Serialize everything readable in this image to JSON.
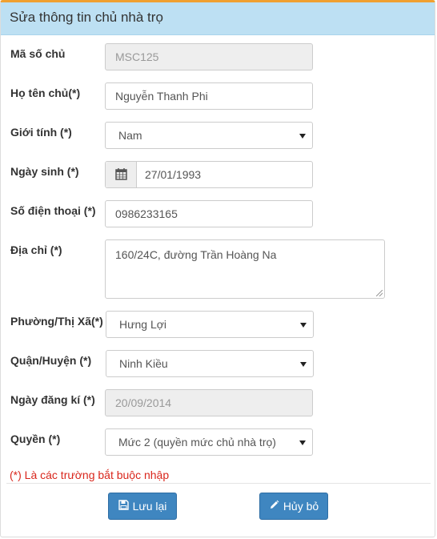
{
  "header": {
    "title": "Sửa thông tin chủ nhà trọ"
  },
  "fields": {
    "owner_id": {
      "label": "Mã số chủ",
      "value": "MSC125"
    },
    "full_name": {
      "label": "Họ tên chủ(*)",
      "value": "Nguyễn Thanh Phi"
    },
    "gender": {
      "label": "Giới tính (*)",
      "value": "Nam"
    },
    "birth_date": {
      "label": "Ngày sinh (*)",
      "value": "27/01/1993"
    },
    "phone": {
      "label": "Số điện thoại (*)",
      "value": "0986233165"
    },
    "address": {
      "label": "Địa chỉ (*)",
      "value": "160/24C, đường Trần Hoàng Na"
    },
    "ward": {
      "label": "Phường/Thị Xã(*)",
      "value": "Hưng Lợi"
    },
    "district": {
      "label": "Quận/Huyện (*)",
      "value": "Ninh Kiều"
    },
    "register_date": {
      "label": "Ngày đăng kí (*)",
      "value": "20/09/2014"
    },
    "role": {
      "label": "Quyền (*)",
      "value": "Mức 2 (quyền mức chủ nhà trọ)"
    }
  },
  "note": "(*) Là các trường bắt buộc nhập",
  "buttons": {
    "save": "Lưu lại",
    "cancel": "Hủy bỏ"
  },
  "icons": {
    "calendar": "calendar-icon",
    "save": "floppy-disk-icon",
    "cancel": "pencil-icon"
  },
  "colors": {
    "header_bg": "#bde0f3",
    "header_border_top": "#f0a030",
    "button_bg": "#3f86c0",
    "required_note": "#d9261c"
  }
}
